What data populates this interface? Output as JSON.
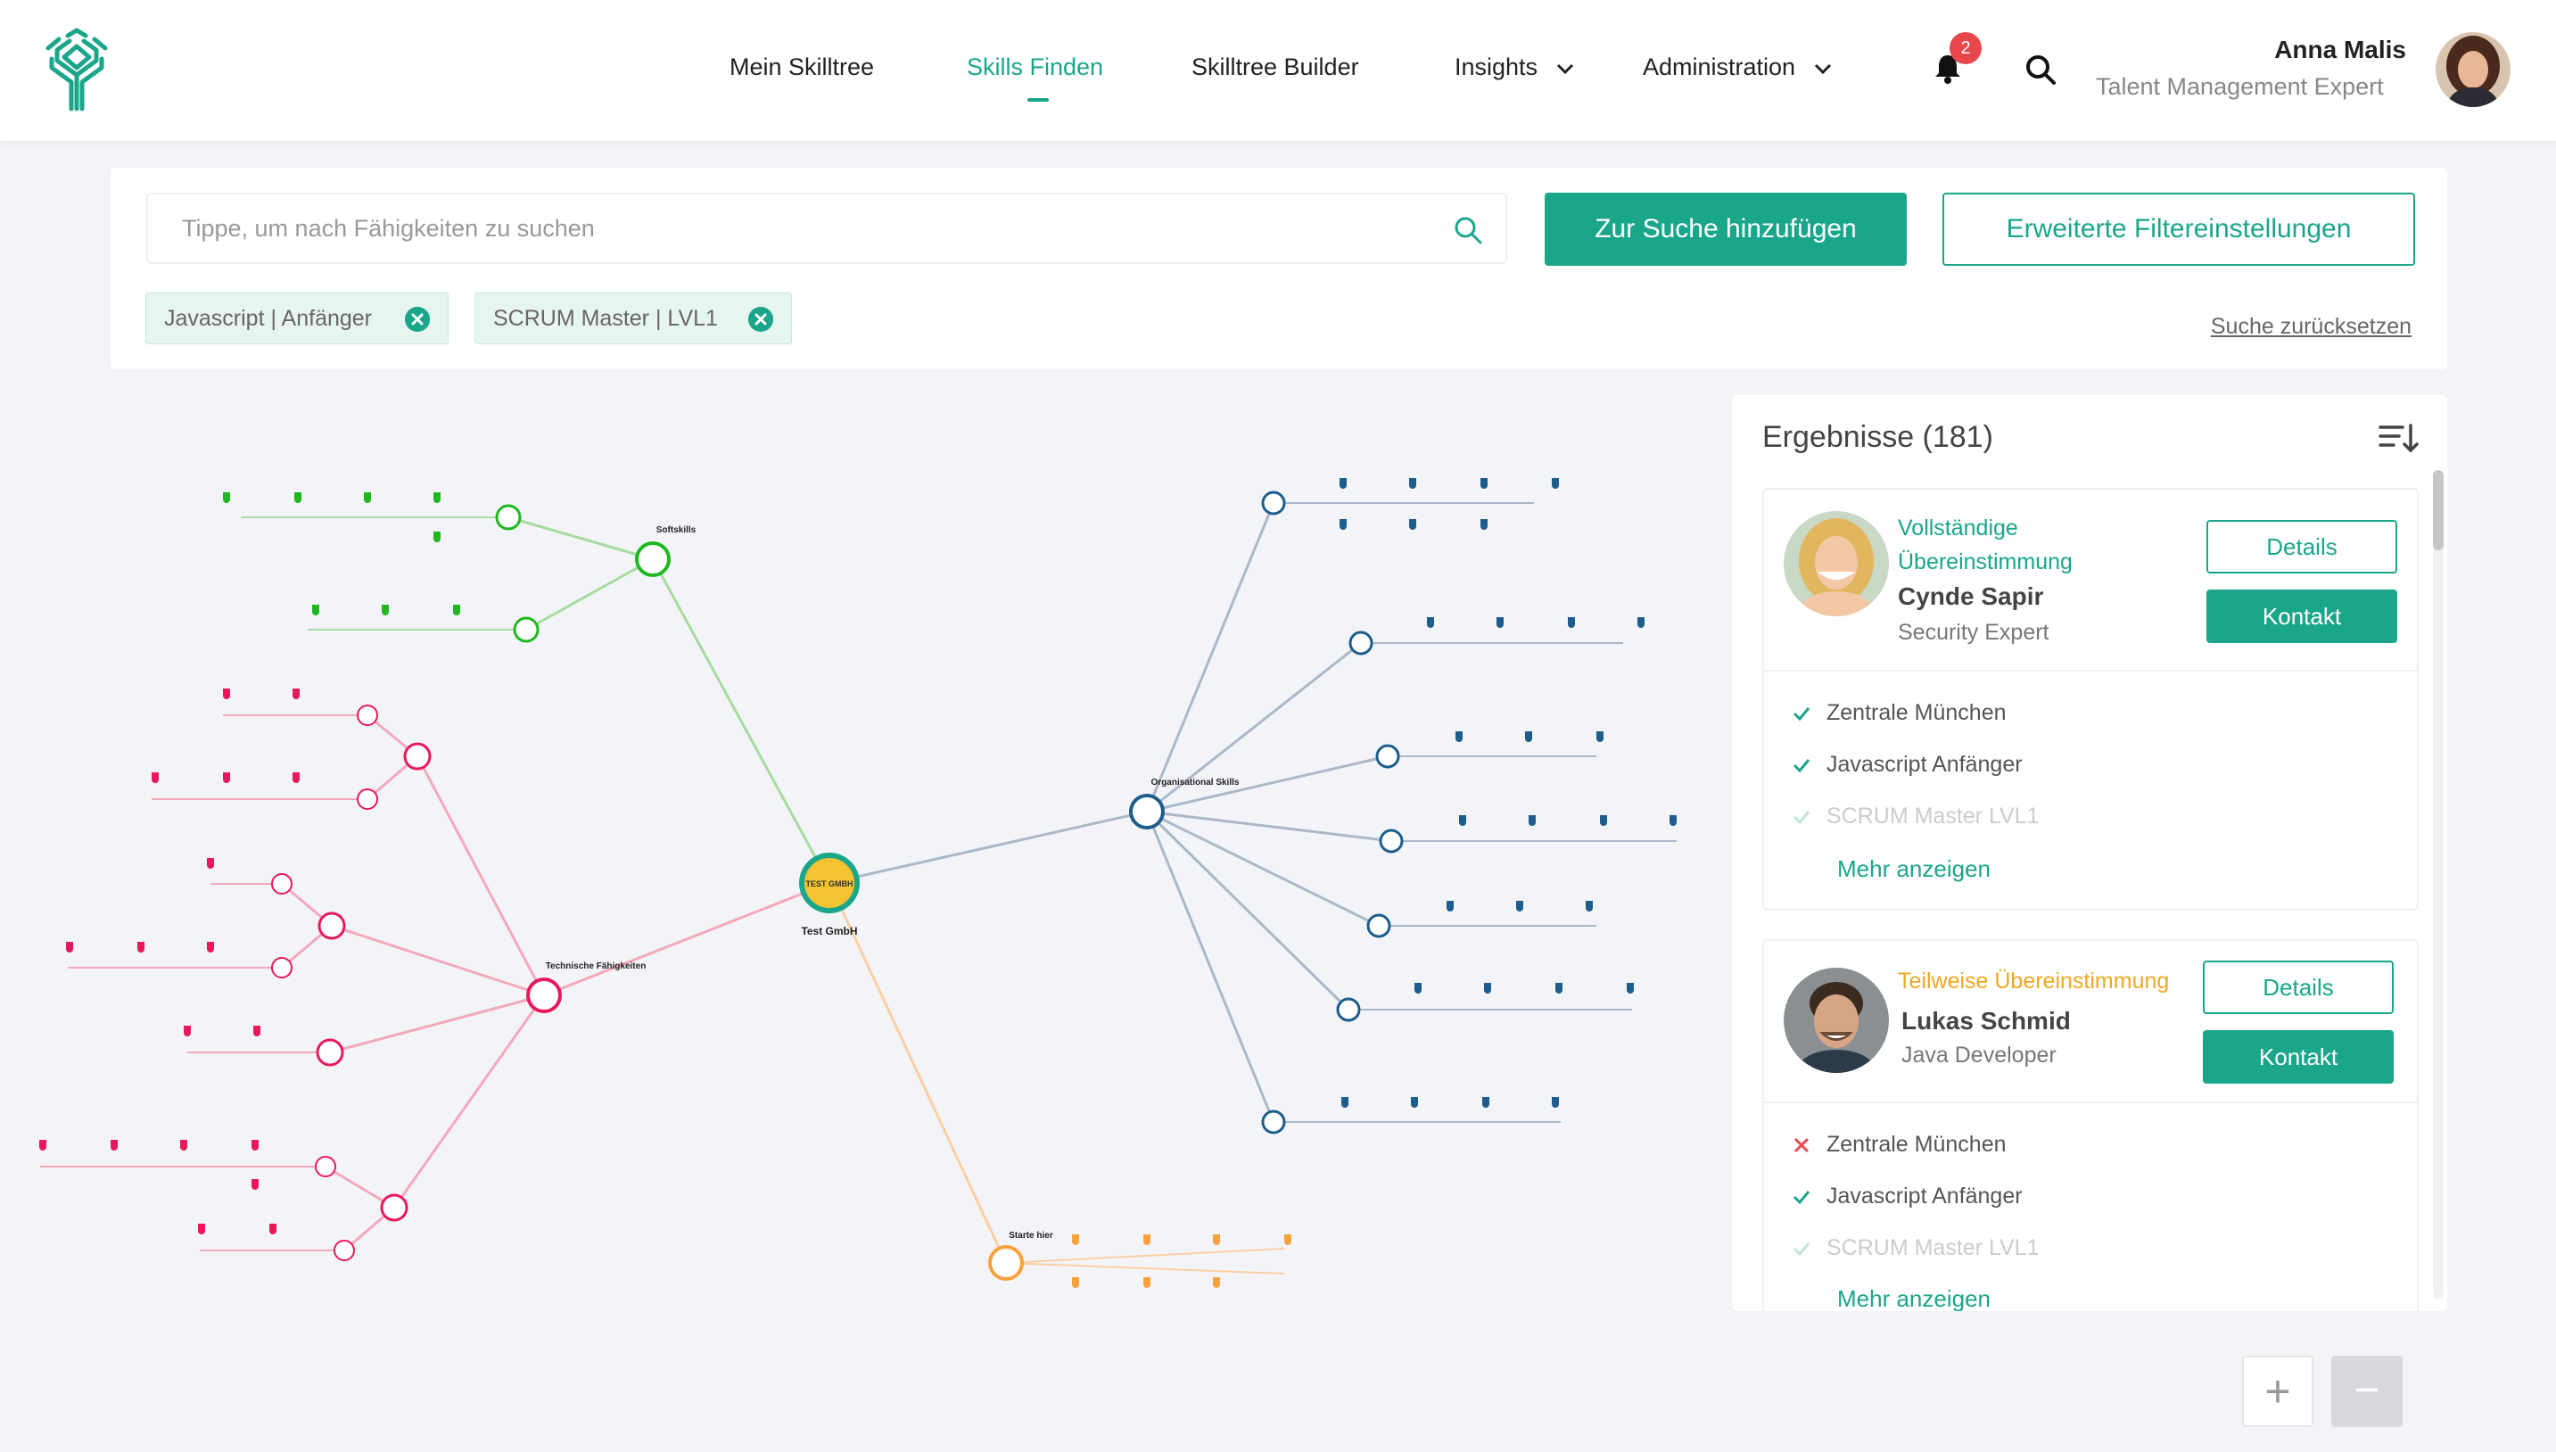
{
  "nav": {
    "items": [
      {
        "label": "Mein Skilltree"
      },
      {
        "label": "Skills Finden"
      },
      {
        "label": "Skilltree Builder"
      },
      {
        "label": "Insights"
      },
      {
        "label": "Administration"
      }
    ],
    "notification_count": "2"
  },
  "user": {
    "name": "Anna Malis",
    "role": "Talent Management Expert"
  },
  "search": {
    "placeholder": "Tippe, um nach Fähigkeiten zu suchen",
    "add_button": "Zur Suche hinzufügen",
    "filter_button": "Erweiterte Filtereinstellungen",
    "reset_link": "Suche zurücksetzen",
    "chips": [
      {
        "label": "Javascript | Anfänger"
      },
      {
        "label": "SCRUM Master | LVL1"
      }
    ]
  },
  "tree": {
    "root": "Test GmbH",
    "logo_text": "TEST GMBH",
    "branches": [
      {
        "label": "Softskills",
        "color": "#1fb81f"
      },
      {
        "label": "Organisational Skills",
        "color": "#1d5d8c"
      },
      {
        "label": "Technische Fähigkeiten",
        "color": "#e8195a"
      },
      {
        "label": "Starte hier",
        "color": "#f7a23c"
      }
    ]
  },
  "results": {
    "title": "Ergebnisse (181)",
    "cards": [
      {
        "match": "Vollständige Übereinstimmung",
        "match_color": "#1aa68a",
        "name": "Cynde Sapir",
        "role": "Security Expert",
        "details": "Details",
        "contact": "Kontakt",
        "criteria": [
          {
            "label": "Zentrale München",
            "status": "ok"
          },
          {
            "label": "Javascript Anfänger",
            "status": "ok"
          },
          {
            "label": "SCRUM Master LVL1",
            "status": "ok"
          }
        ],
        "more": "Mehr anzeigen"
      },
      {
        "match": "Teilweise Übereinstimmung",
        "match_color": "#f0a823",
        "name": "Lukas Schmid",
        "role": "Java Developer",
        "details": "Details",
        "contact": "Kontakt",
        "criteria": [
          {
            "label": "Zentrale München",
            "status": "fail"
          },
          {
            "label": "Javascript Anfänger",
            "status": "ok"
          },
          {
            "label": "SCRUM Master LVL1",
            "status": "ok"
          }
        ],
        "more": "Mehr anzeigen"
      }
    ]
  },
  "zoom": {
    "plus": "+",
    "minus": "−"
  }
}
